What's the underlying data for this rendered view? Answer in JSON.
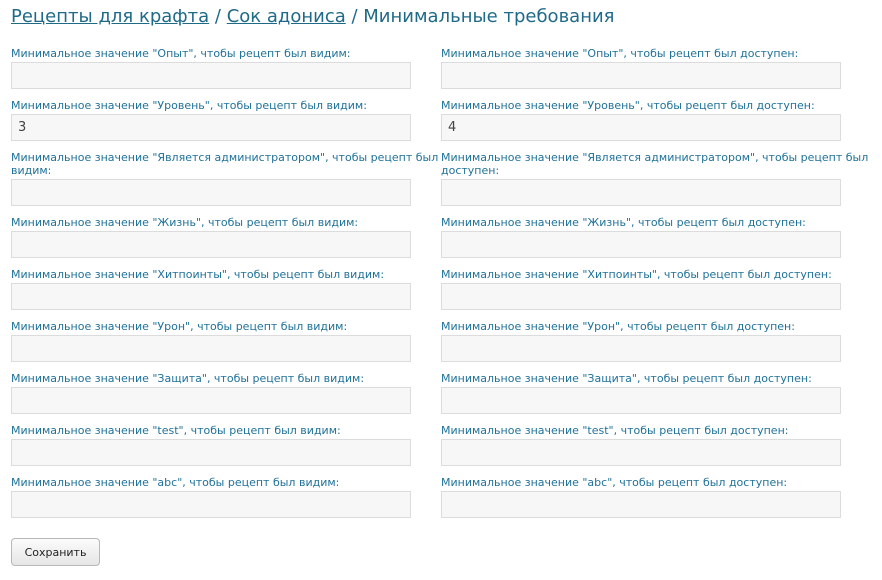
{
  "breadcrumb": {
    "link1": "Рецепты для крафта",
    "sep1": " / ",
    "link2": "Сок адониса",
    "sep2": " / ",
    "current": "Минимальные требования"
  },
  "fields": [
    {
      "visible_label": "Минимальное значение \"Опыт\", чтобы рецепт был видим:",
      "visible_value": "",
      "available_label": "Минимальное значение \"Опыт\", чтобы рецепт был доступен:",
      "available_value": ""
    },
    {
      "visible_label": "Минимальное значение \"Уровень\", чтобы рецепт был видим:",
      "visible_value": "3",
      "available_label": "Минимальное значение \"Уровень\", чтобы рецепт был доступен:",
      "available_value": "4"
    },
    {
      "visible_label": "Минимальное значение \"Является администратором\", чтобы рецепт был видим:",
      "visible_value": "",
      "available_label": "Минимальное значение \"Является администратором\", чтобы рецепт был доступен:",
      "available_value": ""
    },
    {
      "visible_label": "Минимальное значение \"Жизнь\", чтобы рецепт был видим:",
      "visible_value": "",
      "available_label": "Минимальное значение \"Жизнь\", чтобы рецепт был доступен:",
      "available_value": ""
    },
    {
      "visible_label": "Минимальное значение \"Хитпоинты\", чтобы рецепт был видим:",
      "visible_value": "",
      "available_label": "Минимальное значение \"Хитпоинты\", чтобы рецепт был доступен:",
      "available_value": ""
    },
    {
      "visible_label": "Минимальное значение \"Урон\", чтобы рецепт был видим:",
      "visible_value": "",
      "available_label": "Минимальное значение \"Урон\", чтобы рецепт был доступен:",
      "available_value": ""
    },
    {
      "visible_label": "Минимальное значение \"Защита\", чтобы рецепт был видим:",
      "visible_value": "",
      "available_label": "Минимальное значение \"Защита\", чтобы рецепт был доступен:",
      "available_value": ""
    },
    {
      "visible_label": "Минимальное значение \"test\", чтобы рецепт был видим:",
      "visible_value": "",
      "available_label": "Минимальное значение \"test\", чтобы рецепт был доступен:",
      "available_value": ""
    },
    {
      "visible_label": "Минимальное значение \"abc\", чтобы рецепт был видим:",
      "visible_value": "",
      "available_label": "Минимальное значение \"abc\", чтобы рецепт был доступен:",
      "available_value": ""
    }
  ],
  "save_label": "Сохранить",
  "colors": {
    "link": "#1f6a87",
    "label": "#1f7199",
    "input_bg": "#f7f7f7",
    "input_border": "#dcdcdc"
  }
}
